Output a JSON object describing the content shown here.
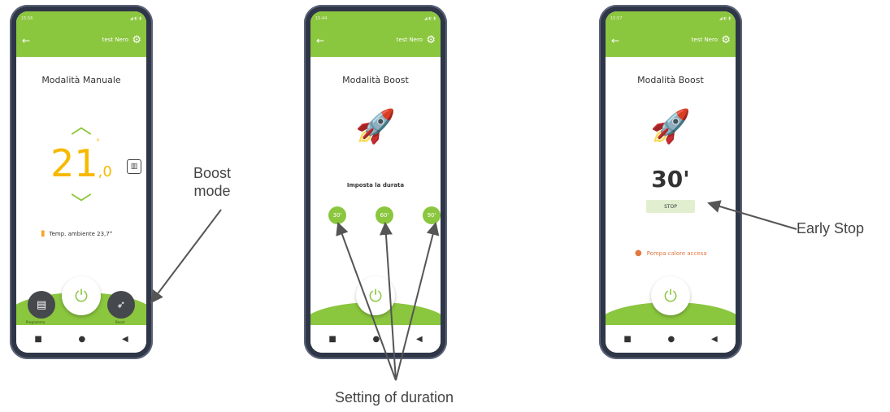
{
  "phones": [
    {
      "status_time": "15:56",
      "status_icons": "◢ ◐ ▮",
      "user": "test Nero",
      "title": "Modalità Manuale",
      "temp_int": "21",
      "temp_dec": ",0",
      "temp_unit": "°",
      "ambient": "Temp. ambiente 23,7°",
      "left_button_label": "Programma",
      "right_button_label": "Boost"
    },
    {
      "status_time": "15:44",
      "status_icons": "◢ ◐ ▮",
      "user": "test Nero",
      "title": "Modalità Boost",
      "duration_label": "Imposta la durata",
      "durations": [
        "30'",
        "60'",
        "90'"
      ]
    },
    {
      "status_time": "15:57",
      "status_icons": "◢ ◐ ▮",
      "user": "test Nero",
      "title": "Modalità Boost",
      "timer": "30'",
      "stop_label": "STOP",
      "pump_status": "Pompa calore accesa"
    }
  ],
  "annotations": {
    "boost_mode": "Boost\nmode",
    "early_stop": "Early Stop",
    "setting_duration": "Setting of duration"
  },
  "colors": {
    "accent_green": "#8bc63f",
    "temp_yellow": "#f7b900",
    "pump_orange": "#e07840",
    "phone_frame": "#2f3648"
  },
  "icons": {
    "back": "arrow-left-icon",
    "settings": "gear-icon",
    "power": "power-icon",
    "rocket": "rocket-icon",
    "calendar": "calendar-icon",
    "chart": "bar-chart-icon",
    "thermometer": "thermometer-icon",
    "drop": "flame-drop-icon"
  }
}
